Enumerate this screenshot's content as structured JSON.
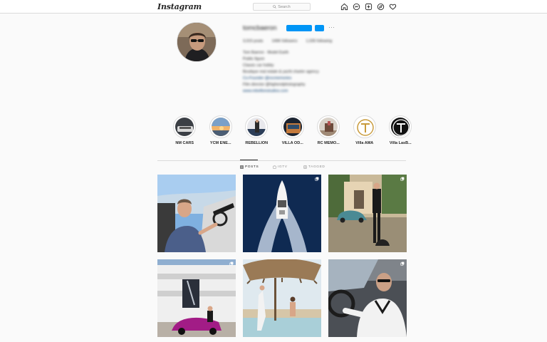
{
  "nav": {
    "logo": "Instagram",
    "search_placeholder": "Search",
    "icons": [
      "home-icon",
      "messenger-icon",
      "new-post-icon",
      "explore-icon",
      "activity-heart-icon"
    ]
  },
  "profile": {
    "username": "tomcbaeron",
    "more": "···",
    "stats": [
      "3,015 posts",
      "149K followers",
      "1,035 following"
    ],
    "bio_lines": [
      "Tom Baeron · Model Earth",
      "Public figure",
      "Classic car hobby",
      "Boutique real estate & yacht charter agency",
      "Co-Founder @rocmemories",
      "Film director @highendphotography",
      "www.rebellionstudios.com"
    ]
  },
  "highlights": [
    {
      "label": "NM CARS",
      "icon": "car-highlight"
    },
    {
      "label": "YCM ENE...",
      "icon": "sunset-highlight"
    },
    {
      "label": "REBELLION",
      "icon": "person-highlight"
    },
    {
      "label": "VILLA OD...",
      "icon": "villa-highlight"
    },
    {
      "label": "RC MEMO...",
      "icon": "memories-highlight"
    },
    {
      "label": "Villa AMA",
      "icon": "t-logo-highlight"
    },
    {
      "label": "Villa LasB...",
      "icon": "t-dark-logo-highlight"
    }
  ],
  "tabs": [
    {
      "label": "POSTS",
      "icon": "grid-icon",
      "active": true
    },
    {
      "label": "IGTV",
      "icon": "igtv-icon",
      "active": false
    },
    {
      "label": "TAGGED",
      "icon": "tagged-icon",
      "active": false
    }
  ],
  "posts": [
    {
      "name": "man-driving-convertible",
      "multi": false
    },
    {
      "name": "speedboat-aerial",
      "multi": true
    },
    {
      "name": "tuxedo-vintage-car-dog",
      "multi": true
    },
    {
      "name": "pink-supercar-yacht",
      "multi": true
    },
    {
      "name": "beach-umbrella-couple",
      "multi": false
    },
    {
      "name": "tuxedo-man-driving",
      "multi": true
    }
  ],
  "colors": {
    "accent": "#0095f6",
    "border": "#dbdbdb",
    "text": "#262626",
    "muted": "#8e8e8e"
  }
}
